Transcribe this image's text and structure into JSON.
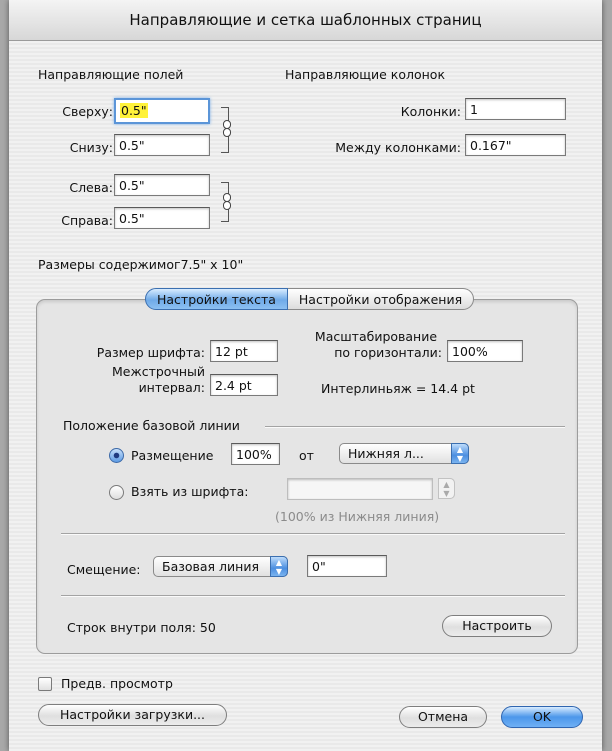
{
  "dialog": {
    "title": "Направляющие и сетка шаблонных страниц"
  },
  "margins": {
    "heading": "Направляющие полей",
    "top_label": "Сверху:",
    "top_value": "0.5\"",
    "bottom_label": "Снизу:",
    "bottom_value": "0.5\"",
    "left_label": "Слева:",
    "left_value": "0.5\"",
    "right_label": "Справа:",
    "right_value": "0.5\""
  },
  "columns": {
    "heading": "Направляющие колонок",
    "columns_label": "Колонки:",
    "columns_value": "1",
    "gutter_label": "Между колонками:",
    "gutter_value": "0.167\""
  },
  "content_size": {
    "label": "Размеры содержимог",
    "value": "7.5\" x 10\""
  },
  "tabs": [
    {
      "label": "Настройки текста",
      "selected": true
    },
    {
      "label": "Настройки отображения",
      "selected": false
    }
  ],
  "text_settings": {
    "font_size_label": "Размер шрифта:",
    "font_size_value": "12 pt",
    "leading_label_1": "Межстрочный",
    "leading_label_2": "интервал:",
    "leading_value": "2.4 pt",
    "hscale_label_1": "Масштабирование",
    "hscale_label_2": "по горизонтали:",
    "hscale_value": "100%",
    "interline_label": "Интерлиньяж =",
    "interline_value": "14.4 pt"
  },
  "baseline": {
    "heading": "Положение базовой линии",
    "placement_label": "Размещение",
    "placement_value": "100%",
    "from_label": "от",
    "placement_popup": "Нижняя л...",
    "from_font_label": "Взять из шрифта:",
    "from_font_value": "",
    "hint": "(100% из Нижняя линия)"
  },
  "offset": {
    "label": "Смещение:",
    "popup": "Базовая линия",
    "value": "0\""
  },
  "lines": {
    "label": "Строк внутри поля:",
    "value": "50",
    "configure_button": "Настроить"
  },
  "footer": {
    "preview_label": "Предв. просмотр",
    "load_settings_button": "Настройки загрузки...",
    "cancel_button": "Отмена",
    "ok_button": "OK"
  },
  "colors": {
    "accent": "#5b95d8",
    "highlight": "#fff23a"
  }
}
